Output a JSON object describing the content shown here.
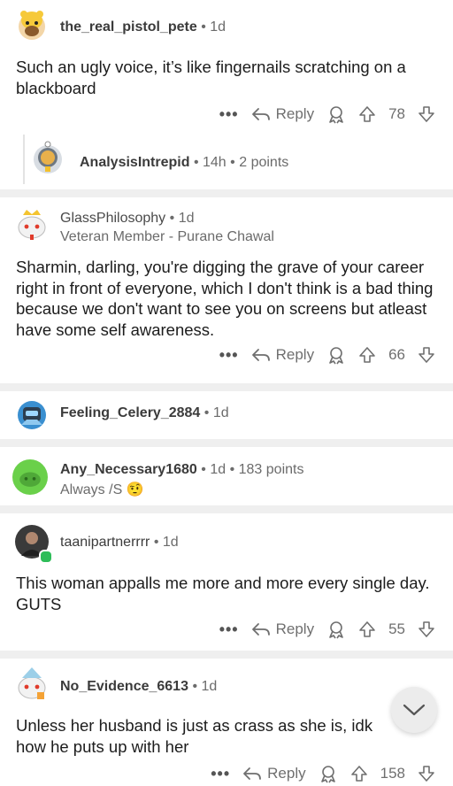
{
  "comments": [
    {
      "username": "the_real_pistol_pete",
      "time": "1d",
      "body": "Such an ugly voice, it’s like fingernails scratching on a blackboard",
      "score": "78",
      "reply_label": "Reply",
      "avatar_icon": "cow-avatar-icon"
    },
    {
      "username": "AnalysisIntrepid",
      "time": "14h",
      "points": "2 points",
      "avatar_icon": "astronaut-avatar-icon"
    },
    {
      "username": "GlassPhilosophy",
      "time": "1d",
      "flair": "Veteran Member - Purane Chawal",
      "body": "Sharmin, darling, you're digging the grave of your career right in front of everyone, which I don't think is a bad thing because we don't want to see you on screens but atleast have some self awareness.",
      "score": "66",
      "reply_label": "Reply",
      "avatar_icon": "snoo-crown-avatar-icon"
    },
    {
      "username": "Feeling_Celery_2884",
      "time": "1d",
      "avatar_icon": "robot-avatar-icon"
    },
    {
      "username": "Any_Necessary1680",
      "time": "1d",
      "points": "183 points",
      "flair": "Always /S",
      "flair_emoji": "🤨",
      "avatar_icon": "green-snoo-avatar-icon"
    },
    {
      "username": "taanipartnerrrr",
      "time": "1d",
      "body": "This woman appalls me more and more every single day. GUTS",
      "score": "55",
      "reply_label": "Reply",
      "avatar_icon": "photo-avatar-icon",
      "online_color": "#2ebd59"
    },
    {
      "username": "No_Evidence_6613",
      "time": "1d",
      "body_line1": "Unless her husband is just as crass as she is, idk",
      "body_line2": "how he puts up with her",
      "score": "158",
      "reply_label": "Reply",
      "avatar_icon": "snoo-wizard-avatar-icon"
    }
  ],
  "more_label": "•••",
  "separator": "•",
  "colors": {
    "background": "#ffffff",
    "divider": "#efefef",
    "meta_text": "#6b6b6b",
    "online": "#2ebd59"
  }
}
